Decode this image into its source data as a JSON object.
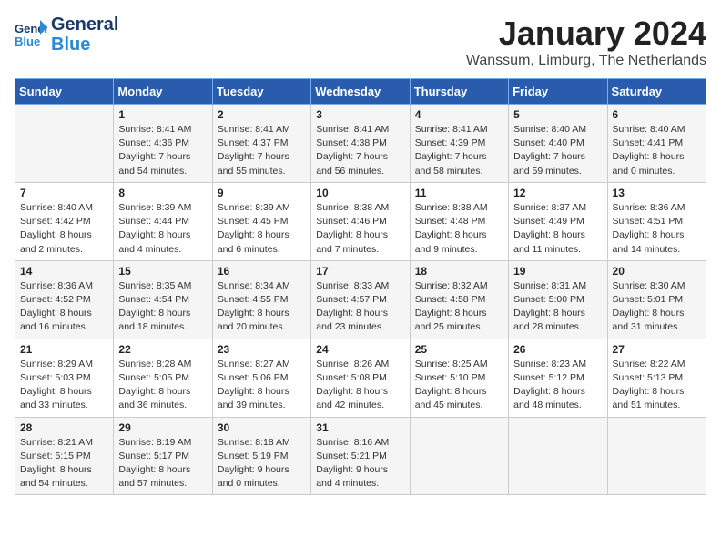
{
  "logo": {
    "line1": "General",
    "line2": "Blue"
  },
  "title": "January 2024",
  "location": "Wanssum, Limburg, The Netherlands",
  "days_of_week": [
    "Sunday",
    "Monday",
    "Tuesday",
    "Wednesday",
    "Thursday",
    "Friday",
    "Saturday"
  ],
  "weeks": [
    [
      {
        "day": "",
        "details": ""
      },
      {
        "day": "1",
        "details": "Sunrise: 8:41 AM\nSunset: 4:36 PM\nDaylight: 7 hours\nand 54 minutes."
      },
      {
        "day": "2",
        "details": "Sunrise: 8:41 AM\nSunset: 4:37 PM\nDaylight: 7 hours\nand 55 minutes."
      },
      {
        "day": "3",
        "details": "Sunrise: 8:41 AM\nSunset: 4:38 PM\nDaylight: 7 hours\nand 56 minutes."
      },
      {
        "day": "4",
        "details": "Sunrise: 8:41 AM\nSunset: 4:39 PM\nDaylight: 7 hours\nand 58 minutes."
      },
      {
        "day": "5",
        "details": "Sunrise: 8:40 AM\nSunset: 4:40 PM\nDaylight: 7 hours\nand 59 minutes."
      },
      {
        "day": "6",
        "details": "Sunrise: 8:40 AM\nSunset: 4:41 PM\nDaylight: 8 hours\nand 0 minutes."
      }
    ],
    [
      {
        "day": "7",
        "details": "Sunrise: 8:40 AM\nSunset: 4:42 PM\nDaylight: 8 hours\nand 2 minutes."
      },
      {
        "day": "8",
        "details": "Sunrise: 8:39 AM\nSunset: 4:44 PM\nDaylight: 8 hours\nand 4 minutes."
      },
      {
        "day": "9",
        "details": "Sunrise: 8:39 AM\nSunset: 4:45 PM\nDaylight: 8 hours\nand 6 minutes."
      },
      {
        "day": "10",
        "details": "Sunrise: 8:38 AM\nSunset: 4:46 PM\nDaylight: 8 hours\nand 7 minutes."
      },
      {
        "day": "11",
        "details": "Sunrise: 8:38 AM\nSunset: 4:48 PM\nDaylight: 8 hours\nand 9 minutes."
      },
      {
        "day": "12",
        "details": "Sunrise: 8:37 AM\nSunset: 4:49 PM\nDaylight: 8 hours\nand 11 minutes."
      },
      {
        "day": "13",
        "details": "Sunrise: 8:36 AM\nSunset: 4:51 PM\nDaylight: 8 hours\nand 14 minutes."
      }
    ],
    [
      {
        "day": "14",
        "details": "Sunrise: 8:36 AM\nSunset: 4:52 PM\nDaylight: 8 hours\nand 16 minutes."
      },
      {
        "day": "15",
        "details": "Sunrise: 8:35 AM\nSunset: 4:54 PM\nDaylight: 8 hours\nand 18 minutes."
      },
      {
        "day": "16",
        "details": "Sunrise: 8:34 AM\nSunset: 4:55 PM\nDaylight: 8 hours\nand 20 minutes."
      },
      {
        "day": "17",
        "details": "Sunrise: 8:33 AM\nSunset: 4:57 PM\nDaylight: 8 hours\nand 23 minutes."
      },
      {
        "day": "18",
        "details": "Sunrise: 8:32 AM\nSunset: 4:58 PM\nDaylight: 8 hours\nand 25 minutes."
      },
      {
        "day": "19",
        "details": "Sunrise: 8:31 AM\nSunset: 5:00 PM\nDaylight: 8 hours\nand 28 minutes."
      },
      {
        "day": "20",
        "details": "Sunrise: 8:30 AM\nSunset: 5:01 PM\nDaylight: 8 hours\nand 31 minutes."
      }
    ],
    [
      {
        "day": "21",
        "details": "Sunrise: 8:29 AM\nSunset: 5:03 PM\nDaylight: 8 hours\nand 33 minutes."
      },
      {
        "day": "22",
        "details": "Sunrise: 8:28 AM\nSunset: 5:05 PM\nDaylight: 8 hours\nand 36 minutes."
      },
      {
        "day": "23",
        "details": "Sunrise: 8:27 AM\nSunset: 5:06 PM\nDaylight: 8 hours\nand 39 minutes."
      },
      {
        "day": "24",
        "details": "Sunrise: 8:26 AM\nSunset: 5:08 PM\nDaylight: 8 hours\nand 42 minutes."
      },
      {
        "day": "25",
        "details": "Sunrise: 8:25 AM\nSunset: 5:10 PM\nDaylight: 8 hours\nand 45 minutes."
      },
      {
        "day": "26",
        "details": "Sunrise: 8:23 AM\nSunset: 5:12 PM\nDaylight: 8 hours\nand 48 minutes."
      },
      {
        "day": "27",
        "details": "Sunrise: 8:22 AM\nSunset: 5:13 PM\nDaylight: 8 hours\nand 51 minutes."
      }
    ],
    [
      {
        "day": "28",
        "details": "Sunrise: 8:21 AM\nSunset: 5:15 PM\nDaylight: 8 hours\nand 54 minutes."
      },
      {
        "day": "29",
        "details": "Sunrise: 8:19 AM\nSunset: 5:17 PM\nDaylight: 8 hours\nand 57 minutes."
      },
      {
        "day": "30",
        "details": "Sunrise: 8:18 AM\nSunset: 5:19 PM\nDaylight: 9 hours\nand 0 minutes."
      },
      {
        "day": "31",
        "details": "Sunrise: 8:16 AM\nSunset: 5:21 PM\nDaylight: 9 hours\nand 4 minutes."
      },
      {
        "day": "",
        "details": ""
      },
      {
        "day": "",
        "details": ""
      },
      {
        "day": "",
        "details": ""
      }
    ]
  ]
}
